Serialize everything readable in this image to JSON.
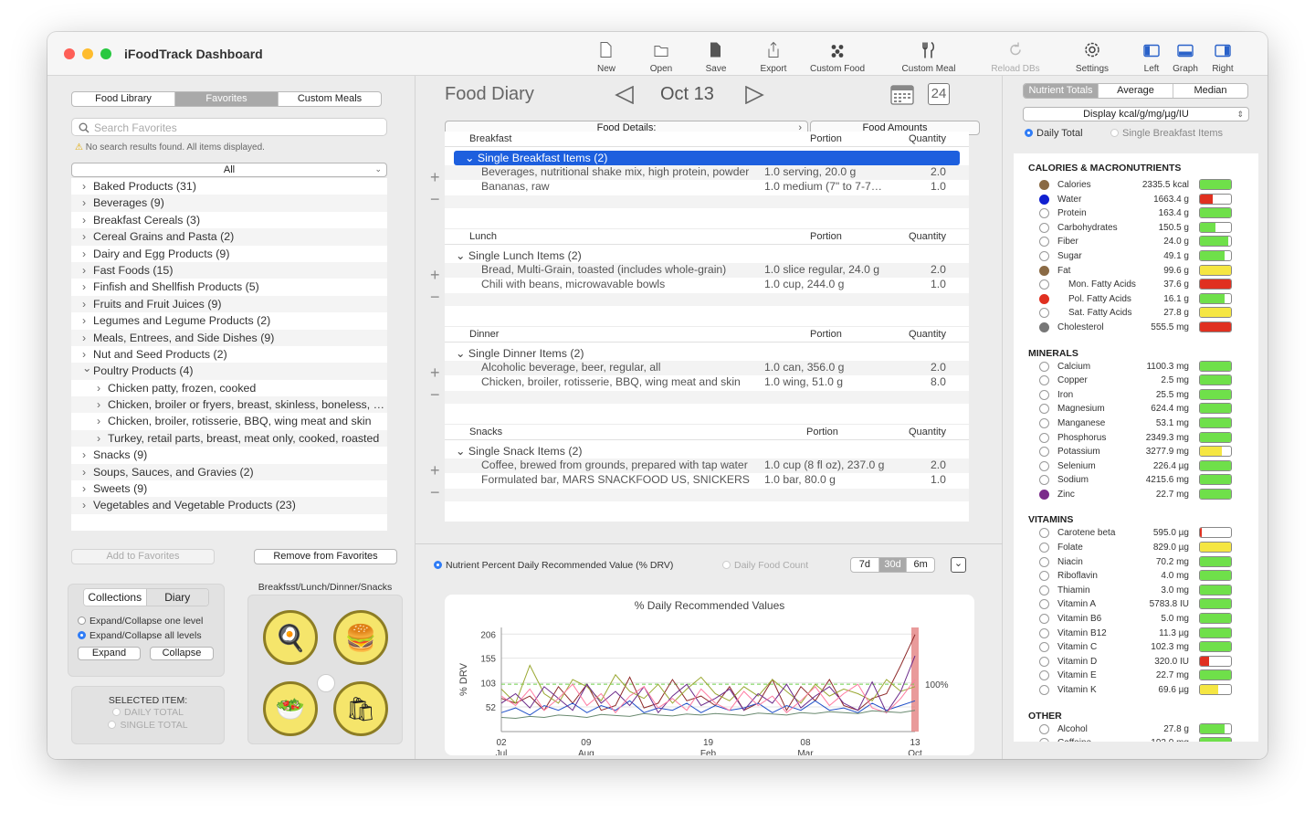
{
  "window": {
    "title": "iFoodTrack Dashboard"
  },
  "toolbar": [
    {
      "label": "New",
      "icon": "new-document-icon",
      "enabled": true
    },
    {
      "label": "Open",
      "icon": "folder-icon",
      "enabled": true
    },
    {
      "label": "Save",
      "icon": "save-document-icon",
      "enabled": true
    },
    {
      "label": "Export",
      "icon": "export-icon",
      "enabled": true
    },
    {
      "label": "Custom Food",
      "icon": "custom-food-icon",
      "enabled": true
    },
    {
      "label": "Custom Meal",
      "icon": "fork-knife-icon",
      "enabled": true
    },
    {
      "label": "Reload DBs",
      "icon": "reload-icon",
      "enabled": false
    },
    {
      "label": "Settings",
      "icon": "gear-icon",
      "enabled": true
    },
    {
      "label": "Left",
      "icon": "left-panel-icon",
      "enabled": true
    },
    {
      "label": "Graph",
      "icon": "graph-panel-icon",
      "enabled": true
    },
    {
      "label": "Right",
      "icon": "right-panel-icon",
      "enabled": true
    }
  ],
  "left": {
    "tabs": [
      "Food Library",
      "Favorites",
      "Custom Meals"
    ],
    "active_tab": "Favorites",
    "search_placeholder": "Search Favorites",
    "warning": "No search results found. All items displayed.",
    "filter": "All",
    "categories": [
      {
        "label": "Baked Products (31)",
        "expanded": false,
        "level": 0
      },
      {
        "label": "Beverages (9)",
        "expanded": false,
        "level": 0
      },
      {
        "label": "Breakfast Cereals (3)",
        "expanded": false,
        "level": 0
      },
      {
        "label": "Cereal Grains and Pasta (2)",
        "expanded": false,
        "level": 0
      },
      {
        "label": "Dairy and Egg Products (9)",
        "expanded": false,
        "level": 0
      },
      {
        "label": "Fast Foods (15)",
        "expanded": false,
        "level": 0
      },
      {
        "label": "Finfish and Shellfish Products (5)",
        "expanded": false,
        "level": 0
      },
      {
        "label": "Fruits and Fruit Juices (9)",
        "expanded": false,
        "level": 0
      },
      {
        "label": "Legumes and Legume Products (2)",
        "expanded": false,
        "level": 0
      },
      {
        "label": "Meals, Entrees, and Side Dishes (9)",
        "expanded": false,
        "level": 0
      },
      {
        "label": "Nut and Seed Products (2)",
        "expanded": false,
        "level": 0
      },
      {
        "label": "Poultry Products (4)",
        "expanded": true,
        "level": 0
      },
      {
        "label": "Chicken patty, frozen, cooked",
        "expanded": false,
        "level": 1
      },
      {
        "label": "Chicken, broiler or fryers, breast, skinless, boneless, meat only, cooked, braised",
        "expanded": false,
        "level": 1
      },
      {
        "label": "Chicken, broiler, rotisserie, BBQ, wing meat and skin",
        "expanded": false,
        "level": 1
      },
      {
        "label": "Turkey, retail parts, breast, meat only, cooked, roasted",
        "expanded": false,
        "level": 1
      },
      {
        "label": "Snacks (9)",
        "expanded": false,
        "level": 0
      },
      {
        "label": "Soups, Sauces, and Gravies (2)",
        "expanded": false,
        "level": 0
      },
      {
        "label": "Sweets (9)",
        "expanded": false,
        "level": 0
      },
      {
        "label": "Vegetables and Vegetable Products (23)",
        "expanded": false,
        "level": 0
      }
    ],
    "add_fav": "Add to Favorites",
    "remove_fav": "Remove from Favorites",
    "coll_tabs": [
      "Collections",
      "Diary"
    ],
    "coll_opts": [
      "Expand/Collapse one level",
      "Expand/Collapse all levels"
    ],
    "expand": "Expand",
    "collapse": "Collapse",
    "selected_title": "SELECTED ITEM:",
    "selected_opts": [
      "DAILY TOTAL",
      "SINGLE TOTAL"
    ],
    "meals_title": "Breakfsst/Lunch/Dinner/Snacks"
  },
  "diary": {
    "title": "Food Diary",
    "date": "Oct 13",
    "day_badge": "24",
    "details_header": "Food Details:",
    "amounts_header": "Food Amounts",
    "col_portion": "Portion",
    "col_qty": "Quantity",
    "meals": [
      {
        "name": "Breakfast",
        "group": "Single Breakfast Items (2)",
        "selected": true,
        "items": [
          {
            "food": "Beverages, nutritional shake mix, high protein, powder",
            "portion": "1.0 serving, 20.0 g",
            "qty": "2.0"
          },
          {
            "food": "Bananas, raw",
            "portion": "1.0 medium (7\" to 7-7…",
            "qty": "1.0"
          }
        ]
      },
      {
        "name": "Lunch",
        "group": "Single Lunch Items (2)",
        "selected": false,
        "items": [
          {
            "food": "Bread, Multi-Grain, toasted (includes whole-grain)",
            "portion": "1.0 slice regular, 24.0 g",
            "qty": "2.0"
          },
          {
            "food": "Chili with beans, microwavable bowls",
            "portion": "1.0 cup, 244.0 g",
            "qty": "1.0"
          }
        ]
      },
      {
        "name": "Dinner",
        "group": "Single Dinner Items (2)",
        "selected": false,
        "items": [
          {
            "food": "Alcoholic beverage, beer, regular, all",
            "portion": "1.0 can, 356.0 g",
            "qty": "2.0"
          },
          {
            "food": "Chicken, broiler, rotisserie, BBQ, wing meat and skin",
            "portion": "1.0 wing, 51.0 g",
            "qty": "8.0"
          }
        ]
      },
      {
        "name": "Snacks",
        "group": "Single Snack Items (2)",
        "selected": false,
        "items": [
          {
            "food": "Coffee, brewed from grounds, prepared with tap water",
            "portion": "1.0 cup (8 fl oz), 237.0 g",
            "qty": "2.0"
          },
          {
            "food": "Formulated bar, MARS SNACKFOOD US, SNICKERS",
            "portion": "1.0 bar, 80.0 g",
            "qty": "1.0"
          }
        ]
      }
    ]
  },
  "graph_controls": {
    "opt_drv": "Nutrient Percent Daily Recommended Value (% DRV)",
    "opt_count": "Daily Food Count",
    "ranges": [
      "7d",
      "30d",
      "6m"
    ],
    "active_range": "30d"
  },
  "chart_data": {
    "type": "line",
    "title": "% Daily Recommended Values",
    "ylabel": "% DRV",
    "ylim": [
      0,
      220
    ],
    "yticks": [
      52,
      103,
      155,
      206
    ],
    "xticks": [
      {
        "d": "02",
        "m": "Jul"
      },
      {
        "d": "09",
        "m": "Aug"
      },
      {
        "d": "19",
        "m": "Feb"
      },
      {
        "d": "08",
        "m": "Mar"
      },
      {
        "d": "13",
        "m": "Oct"
      }
    ],
    "reference_line": {
      "value": 100,
      "label": "100%"
    },
    "series": [
      {
        "color": "#8e2a2a",
        "values": [
          70,
          60,
          75,
          45,
          95,
          60,
          100,
          45,
          55,
          115,
          50,
          60,
          110,
          65,
          75,
          55,
          95,
          45,
          60,
          110,
          45,
          95,
          65,
          110,
          55,
          45,
          70,
          80,
          140,
          205
        ]
      },
      {
        "color": "#2050c8",
        "values": [
          40,
          50,
          35,
          55,
          45,
          60,
          40,
          55,
          45,
          65,
          40,
          50,
          45,
          60,
          40,
          55,
          45,
          50,
          60,
          40,
          55,
          45,
          65,
          45,
          50,
          40,
          60,
          45,
          55,
          65
        ]
      },
      {
        "color": "#9aa832",
        "values": [
          90,
          60,
          140,
          80,
          60,
          110,
          95,
          65,
          120,
          85,
          70,
          100,
          60,
          90,
          115,
          80,
          65,
          95,
          75,
          110,
          85,
          60,
          100,
          75,
          90,
          80,
          65,
          110,
          85,
          95
        ]
      },
      {
        "color": "#6b2a8a",
        "values": [
          60,
          80,
          50,
          95,
          70,
          45,
          100,
          60,
          85,
          55,
          95,
          40,
          75,
          100,
          55,
          70,
          90,
          45,
          80,
          60,
          100,
          50,
          75,
          95,
          60,
          45,
          105,
          40,
          85,
          160
        ]
      },
      {
        "color": "#ff7aa0",
        "values": [
          75,
          55,
          90,
          45,
          70,
          100,
          55,
          80,
          40,
          75,
          95,
          50,
          70,
          45,
          90,
          60,
          45,
          85,
          55,
          75,
          40,
          65,
          95,
          55,
          80,
          100,
          50,
          40,
          70,
          110
        ]
      },
      {
        "color": "#6a8a70",
        "values": [
          30,
          28,
          32,
          30,
          35,
          33,
          30,
          36,
          34,
          32,
          38,
          35,
          33,
          37,
          35,
          38,
          36,
          34,
          39,
          37,
          35,
          40,
          38,
          42,
          40,
          38,
          44,
          42,
          40,
          45
        ]
      }
    ]
  },
  "nutrients": {
    "tabs": [
      "Nutrient Totals",
      "Average",
      "Median"
    ],
    "active_tab": "Nutrient Totals",
    "display": "Display kcal/g/mg/µg/IU",
    "opt_total": "Daily Total",
    "opt_single": "Single Breakfast Items",
    "sections": [
      {
        "title": "CALORIES & MACRONUTRIENTS",
        "rows": [
          {
            "name": "Calories",
            "value": "2335.5 kcal",
            "dot": "#8a6a44",
            "fill": 1.0,
            "color": "#6fe04a",
            "indent": false
          },
          {
            "name": "Water",
            "value": "1663.4 g",
            "dot": "#1020d0",
            "fill": 0.4,
            "color": "#e03020",
            "indent": false
          },
          {
            "name": "Protein",
            "value": "163.4 g",
            "dot": "",
            "fill": 1.0,
            "color": "#6fe04a",
            "indent": false
          },
          {
            "name": "Carbohydrates",
            "value": "150.5 g",
            "dot": "",
            "fill": 0.5,
            "color": "#6fe04a",
            "indent": false
          },
          {
            "name": "Fiber",
            "value": "24.0 g",
            "dot": "",
            "fill": 0.9,
            "color": "#6fe04a",
            "indent": false
          },
          {
            "name": "Sugar",
            "value": "49.1 g",
            "dot": "",
            "fill": 0.8,
            "color": "#6fe04a",
            "indent": false
          },
          {
            "name": "Fat",
            "value": "99.6 g",
            "dot": "#8a6a44",
            "fill": 1.0,
            "color": "#f5e642",
            "indent": false
          },
          {
            "name": "Mon. Fatty Acids",
            "value": "37.6 g",
            "dot": "",
            "fill": 1.0,
            "color": "#e03020",
            "indent": true
          },
          {
            "name": "Pol. Fatty Acids",
            "value": "16.1 g",
            "dot": "#e03020",
            "fill": 0.8,
            "color": "#6fe04a",
            "indent": true
          },
          {
            "name": "Sat. Fatty Acids",
            "value": "27.8 g",
            "dot": "",
            "fill": 1.0,
            "color": "#f5e642",
            "indent": true
          },
          {
            "name": "Cholesterol",
            "value": "555.5 mg",
            "dot": "#777777",
            "fill": 1.0,
            "color": "#e03020",
            "indent": false
          }
        ]
      },
      {
        "title": "MINERALS",
        "rows": [
          {
            "name": "Calcium",
            "value": "1100.3 mg",
            "dot": "",
            "fill": 1.0,
            "color": "#6fe04a",
            "indent": false
          },
          {
            "name": "Copper",
            "value": "2.5 mg",
            "dot": "",
            "fill": 1.0,
            "color": "#6fe04a",
            "indent": false
          },
          {
            "name": "Iron",
            "value": "25.5 mg",
            "dot": "",
            "fill": 1.0,
            "color": "#6fe04a",
            "indent": false
          },
          {
            "name": "Magnesium",
            "value": "624.4 mg",
            "dot": "",
            "fill": 1.0,
            "color": "#6fe04a",
            "indent": false
          },
          {
            "name": "Manganese",
            "value": "53.1 mg",
            "dot": "",
            "fill": 1.0,
            "color": "#6fe04a",
            "indent": false
          },
          {
            "name": "Phosphorus",
            "value": "2349.3 mg",
            "dot": "",
            "fill": 1.0,
            "color": "#6fe04a",
            "indent": false
          },
          {
            "name": "Potassium",
            "value": "3277.9 mg",
            "dot": "",
            "fill": 0.7,
            "color": "#f5e642",
            "indent": false
          },
          {
            "name": "Selenium",
            "value": "226.4 µg",
            "dot": "",
            "fill": 1.0,
            "color": "#6fe04a",
            "indent": false
          },
          {
            "name": "Sodium",
            "value": "4215.6 mg",
            "dot": "",
            "fill": 1.0,
            "color": "#6fe04a",
            "indent": false
          },
          {
            "name": "Zinc",
            "value": "22.7 mg",
            "dot": "#7a2a8a",
            "fill": 1.0,
            "color": "#6fe04a",
            "indent": false
          }
        ]
      },
      {
        "title": "VITAMINS",
        "rows": [
          {
            "name": "Carotene beta",
            "value": "595.0 µg",
            "dot": "",
            "fill": 0.05,
            "color": "#e03020",
            "indent": false
          },
          {
            "name": "Folate",
            "value": "829.0 µg",
            "dot": "",
            "fill": 1.0,
            "color": "#f5e642",
            "indent": false
          },
          {
            "name": "Niacin",
            "value": "70.2 mg",
            "dot": "",
            "fill": 1.0,
            "color": "#6fe04a",
            "indent": false
          },
          {
            "name": "Riboflavin",
            "value": "4.0 mg",
            "dot": "",
            "fill": 1.0,
            "color": "#6fe04a",
            "indent": false
          },
          {
            "name": "Thiamin",
            "value": "3.0 mg",
            "dot": "",
            "fill": 1.0,
            "color": "#6fe04a",
            "indent": false
          },
          {
            "name": "Vitamin A",
            "value": "5783.8 IU",
            "dot": "",
            "fill": 1.0,
            "color": "#6fe04a",
            "indent": false
          },
          {
            "name": "Vitamin B6",
            "value": "5.0 mg",
            "dot": "",
            "fill": 1.0,
            "color": "#6fe04a",
            "indent": false
          },
          {
            "name": "Vitamin B12",
            "value": "11.3 µg",
            "dot": "",
            "fill": 1.0,
            "color": "#6fe04a",
            "indent": false
          },
          {
            "name": "Vitamin C",
            "value": "102.3 mg",
            "dot": "",
            "fill": 1.0,
            "color": "#6fe04a",
            "indent": false
          },
          {
            "name": "Vitamin D",
            "value": "320.0 IU",
            "dot": "",
            "fill": 0.3,
            "color": "#e03020",
            "indent": false
          },
          {
            "name": "Vitamin E",
            "value": "22.7 mg",
            "dot": "",
            "fill": 1.0,
            "color": "#6fe04a",
            "indent": false
          },
          {
            "name": "Vitamin K",
            "value": "69.6 µg",
            "dot": "",
            "fill": 0.6,
            "color": "#f5e642",
            "indent": false
          }
        ]
      },
      {
        "title": "OTHER",
        "rows": [
          {
            "name": "Alcohol",
            "value": "27.8 g",
            "dot": "",
            "fill": 0.8,
            "color": "#6fe04a",
            "indent": false
          },
          {
            "name": "Caffeine",
            "value": "192.0 mg",
            "dot": "",
            "fill": 1.0,
            "color": "#6fe04a",
            "indent": false
          }
        ]
      }
    ]
  }
}
